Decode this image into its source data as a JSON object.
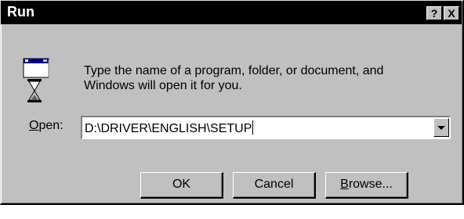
{
  "window": {
    "title": "Run",
    "help_label": "?",
    "close_label": "X"
  },
  "icon": "run-program-icon",
  "description_line1": "Type the name of a program, folder, or document, and",
  "description_line2": "Windows will open it for you.",
  "open": {
    "label_mnemonic": "O",
    "label_rest": "pen:",
    "value": "D:\\DRIVER\\ENGLISH\\SETUP"
  },
  "buttons": {
    "ok": "OK",
    "cancel": "Cancel",
    "browse_mnemonic": "B",
    "browse_rest": "rowse..."
  },
  "colors": {
    "face": "#c0c0c0",
    "titlebar": "#000000",
    "title_text": "#ffffff"
  }
}
